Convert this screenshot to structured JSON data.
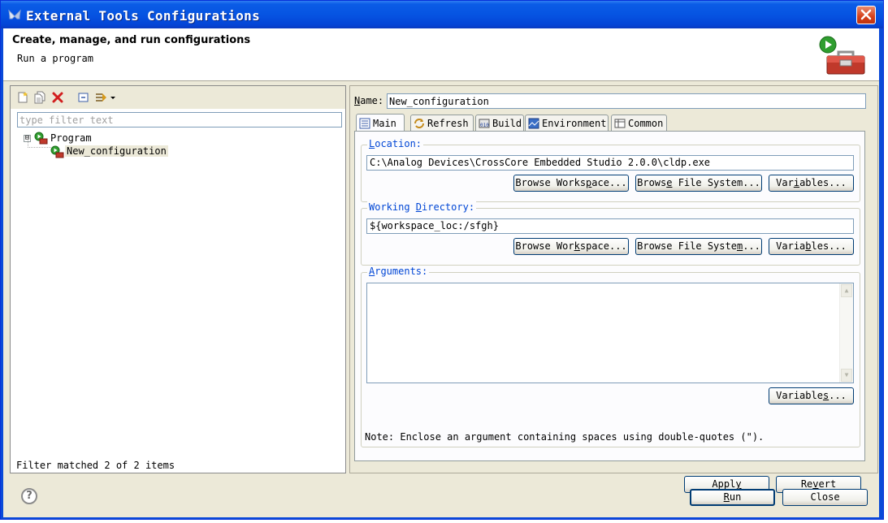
{
  "window": {
    "title": "External Tools Configurations"
  },
  "header": {
    "title": "Create, manage, and run configurations",
    "subtitle": "Run a program"
  },
  "left_panel": {
    "filter_placeholder": "type filter text",
    "tree": {
      "root_label": "Program",
      "root_expander": "⊟",
      "child_label": "New_configuration"
    },
    "status": "Filter matched 2 of 2 items"
  },
  "config": {
    "name_label": "Name:",
    "name_value": "New_configuration",
    "tabs": [
      {
        "label": "Main"
      },
      {
        "label": "Refresh"
      },
      {
        "label": "Build"
      },
      {
        "label": "Environment"
      },
      {
        "label": "Common"
      }
    ],
    "location": {
      "label": "Location:",
      "value": "C:\\Analog Devices\\CrossCore Embedded Studio 2.0.0\\cldp.exe"
    },
    "working_directory": {
      "label": "Working Directory:",
      "value": "${workspace_loc:/sfgh}"
    },
    "arguments": {
      "label": "Arguments:",
      "value": ""
    },
    "buttons": {
      "browse_workspace": "Browse Workspace...",
      "browse_file_system": "Browse File System...",
      "variables": "Variables..."
    },
    "note": "Note: Enclose an argument containing spaces using double-quotes (\")."
  },
  "actions": {
    "apply": "Apply",
    "revert": "Revert",
    "run": "Run",
    "close": "Close",
    "help": "?"
  },
  "colors": {
    "titlebar": "#0654e2",
    "group_label": "#0046d5",
    "dialog_bg": "#ece9d8"
  }
}
